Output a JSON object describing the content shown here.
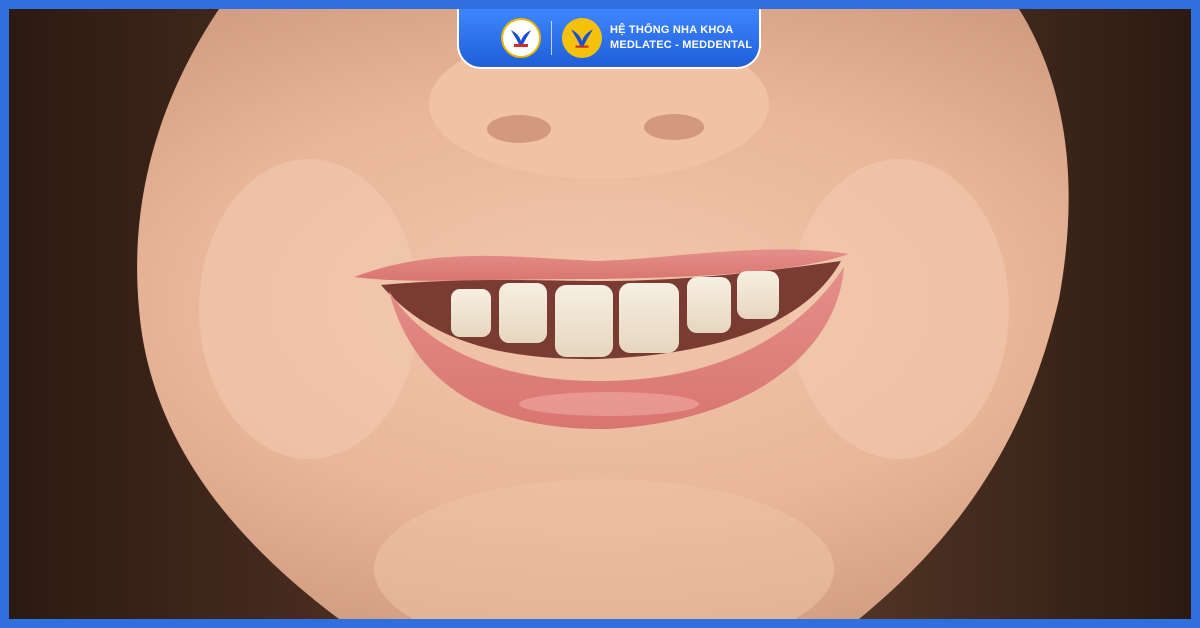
{
  "brand": {
    "line1": "HỆ THỐNG NHA KHOA",
    "line2": "MEDLATEC - MEDDENTAL",
    "logos": [
      "meddental-logo-icon",
      "medlatec-logo-icon"
    ],
    "colors": {
      "frame": "#2f6fe0",
      "badge": "#1f5fd9",
      "logo_gold": "#f4c20d",
      "logo_blue": "#1b4fd1",
      "logo_red": "#d62b2b"
    }
  },
  "photo": {
    "subject": "smiling-mouth-photo"
  }
}
